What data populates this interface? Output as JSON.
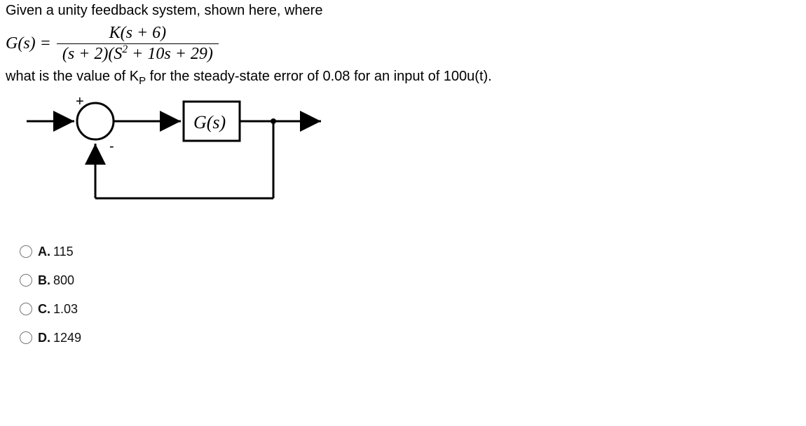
{
  "question": {
    "intro": "Given a unity feedback system, shown here, where",
    "eq_lhs": "G(s) = ",
    "eq_num": "K(s + 6)",
    "eq_den_pre": "(s + 2)(S",
    "eq_den_exp": "2",
    "eq_den_post": " + 10s + 29)",
    "prompt_pre": "what is the value of K",
    "prompt_sub": "P",
    "prompt_post": " for the steady-state error of 0.08 for an input of 100u(t)."
  },
  "diagram": {
    "plus": "+",
    "minus": "-",
    "block": "G(s)"
  },
  "options": [
    {
      "letter": "A.",
      "text": "115"
    },
    {
      "letter": "B.",
      "text": "800"
    },
    {
      "letter": "C.",
      "text": "1.03"
    },
    {
      "letter": "D.",
      "text": "1249"
    }
  ],
  "chart_data": {
    "type": "diagram",
    "description": "Unity-feedback block diagram: arrow into summing junction (+ on top-left input, - on bottom input), output of summer goes into block G(s), block output continues to the right and also feeds back (unity) to the minus input of the summer.",
    "elements": [
      "input-arrow",
      "summing-junction",
      "forward-arrow",
      "block G(s)",
      "output-arrow",
      "unity-feedback-path"
    ]
  }
}
